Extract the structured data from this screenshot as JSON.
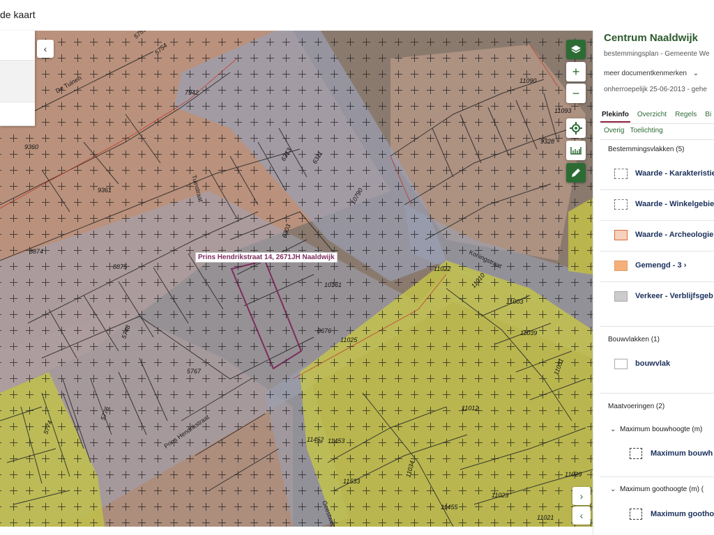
{
  "topbar": {
    "back_label": "de kaart"
  },
  "map": {
    "address_label": "Prins Hendrikstraat 14, 2671JH Naaldwijk",
    "street_labels": [
      "De Tuinen",
      "Tuinstraat",
      "Prins Hendrikstraat",
      "Koningstraat",
      "Geestweg"
    ],
    "parcel_numbers": [
      "5753",
      "5754",
      "7942",
      "9360",
      "9361",
      "8874",
      "8875",
      "10161",
      "6313",
      "6311",
      "10790",
      "8676",
      "11025",
      "11012",
      "11034",
      "11022",
      "11010",
      "11003",
      "11039",
      "11031",
      "11029",
      "11023",
      "9328",
      "11090",
      "11093",
      "11453",
      "11452",
      "11533",
      "11455",
      "11021",
      "11043",
      "6303",
      "5767",
      "5748",
      "5776",
      "5774"
    ],
    "colors": {
      "aerial": "#7d6f66",
      "mixed_overlay": "#c9a089",
      "green_overlay": "#c8c34a",
      "road_overlay": "#9a9aa8",
      "parcel_line": "#2a2a2a",
      "plan_line": "#c0392b",
      "marker": "#2d6b35"
    }
  },
  "controls": {
    "layers_icon": "layers-icon",
    "zoom_in": "+",
    "zoom_out": "−",
    "locate_icon": "locate-icon",
    "measure_icon": "measure-icon",
    "edit_icon": "pencil-icon",
    "collapse_left": "‹",
    "expand_right": "›",
    "expand_left": "‹"
  },
  "sidepanel": {
    "title": "Centrum Naaldwijk",
    "subtitle": "bestemmingsplan - Gemeente We",
    "meta_label": "meer documentkenmerken",
    "status": "onherroepelijk 25-06-2013 - gehe",
    "tabs": [
      "Plekinfo",
      "Overzicht",
      "Regels",
      "Bi"
    ],
    "active_tab": "Plekinfo",
    "subtabs": [
      "Overig",
      "Toelichting"
    ],
    "bestemmingsvlakken": {
      "header": "Bestemmingsvlakken (5)",
      "items": [
        {
          "label": "Waarde - Karakteristie",
          "color": "#ffffff",
          "pattern": "dots"
        },
        {
          "label": "Waarde - Winkelgebie",
          "color": "#ffffff",
          "pattern": "dots"
        },
        {
          "label": "Waarde - Archeologie",
          "color": "#f6d2bd",
          "pattern": "border"
        },
        {
          "label": "Gemengd - 3",
          "color": "#f5b07a",
          "pattern": "fill",
          "suffix": "›"
        },
        {
          "label": "Verkeer - Verblijfsgeb",
          "color": "#cccccc",
          "pattern": "fill"
        }
      ]
    },
    "bouwvlakken": {
      "header": "Bouwvlakken (1)",
      "items": [
        {
          "label": "bouwvlak",
          "color": "#ffffff"
        }
      ]
    },
    "maatvoeringen": {
      "header": "Maatvoeringen (2)",
      "groups": [
        {
          "label": "Maximum bouwhoogte (m)",
          "item": "Maximum bouwh"
        },
        {
          "label": "Maximum goothoogte (m) (",
          "item": "Maximum gootho"
        }
      ]
    }
  }
}
